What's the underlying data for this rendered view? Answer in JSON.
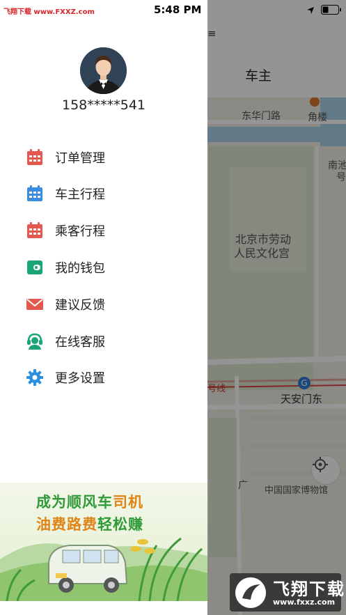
{
  "status_bar": {
    "watermark": "飞翔下载 www.FXXZ.com",
    "time": "5:48 PM",
    "location_icon": "location-arrow-icon",
    "battery_icon": "battery-icon"
  },
  "map": {
    "header_title": "车主",
    "menu_icon_glyph": "≡",
    "labels": {
      "donghuamen": "东华门路",
      "jiaolou": "角楼",
      "nanchi": "南池",
      "hao": "号",
      "culture_palace_line1": "北京市劳动",
      "culture_palace_line2": "人民文化宫",
      "subway_line": "号线",
      "tiananmen_east": "天安门东",
      "museum": "中国国家博物馆",
      "guang": "广"
    },
    "locate_icon": "crosshair-icon"
  },
  "drawer": {
    "avatar_icon": "user-avatar-icon",
    "phone": "158*****541",
    "menu": [
      {
        "label": "订单管理",
        "icon": "calendar-icon",
        "color": "#e5584f"
      },
      {
        "label": "车主行程",
        "icon": "calendar-icon",
        "color": "#3a8de0"
      },
      {
        "label": "乘客行程",
        "icon": "calendar-icon",
        "color": "#e5584f"
      },
      {
        "label": "我的钱包",
        "icon": "wallet-icon",
        "color": "#1aa672"
      },
      {
        "label": "建议反馈",
        "icon": "mail-icon",
        "color": "#e5584f"
      },
      {
        "label": "在线客服",
        "icon": "headset-icon",
        "color": "#1aa672"
      },
      {
        "label": "更多设置",
        "icon": "gear-icon",
        "color": "#2b8fe0"
      }
    ],
    "banner": {
      "line1_a": "成为顺风车",
      "line1_b": "司机",
      "line2_a": "油费路费",
      "line2_b": "轻松赚"
    }
  },
  "watermark_bottom": {
    "text": "飞翔下载",
    "url": "www.fxxz.com"
  }
}
